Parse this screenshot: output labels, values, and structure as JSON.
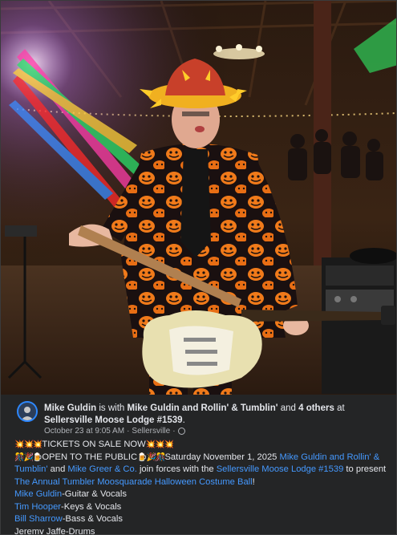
{
  "post": {
    "author": "Mike Guldin",
    "with_text": "is with",
    "tagged_page": "Mike Guldin and Rollin' & Tumblin'",
    "and_text": "and",
    "others": "4 others",
    "at_text": "at",
    "location": "Sellersville Moose Lodge #1539",
    "location_period": ".",
    "timestamp": "October 23 at 9:05 AM",
    "dot": "·",
    "place": "Sellersville",
    "dot2": "·",
    "privacy_icon": "globe-icon",
    "line1_emoji_left": "💥💥💥",
    "line1_text": "TICKETS ON SALE NOW",
    "line1_emoji_right": "💥💥💥",
    "line2_emoji": "🎊🎉🍺",
    "line2_text": "OPEN TO THE PUBLIC",
    "line2_emoji2": "🍺🎉🎊",
    "line2_date": "Saturday November 1, 2025",
    "link1": "Mike Guldin and Rollin' & Tumblin'",
    "and2": "and",
    "link2": "Mike Greer & Co.",
    "join_text": "join forces with the",
    "link3": "Sellersville Moose Lodge #1539",
    "to_present": "to present",
    "link4": "The Annual Tumbler Moosquarade Halloween Costume Ball",
    "exclaim": "!",
    "lineup": [
      {
        "name": "Mike Guldin",
        "role": "-Guitar & Vocals",
        "linked": true
      },
      {
        "name": "Tim Hooper",
        "role": "-Keys & Vocals",
        "linked": true
      },
      {
        "name": "Bill Sharrow",
        "role": "-Bass & Vocals",
        "linked": true
      },
      {
        "name": "Jeremy Jaffe-Drums",
        "role": "",
        "linked": false
      }
    ]
  },
  "colors": {
    "background": "#242526",
    "text": "#e4e6eb",
    "secondary_text": "#b0b3b8",
    "link": "#4599ff"
  }
}
